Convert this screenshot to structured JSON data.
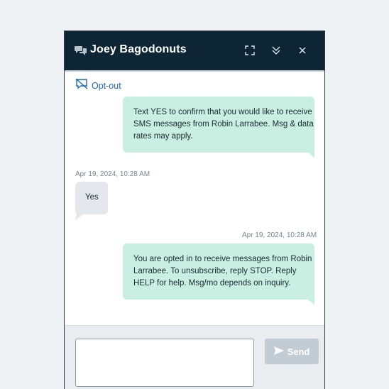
{
  "header": {
    "title": "Joey Bagodonuts",
    "icons": [
      "chat-bubbles-icon",
      "expand-icon",
      "collapse-chevrons-icon",
      "close-icon"
    ]
  },
  "toolbar": {
    "optout_label": "Opt-out"
  },
  "messages": [
    {
      "direction": "outgoing",
      "text": "Text YES to confirm that you would like to receive SMS messages from Robin Larrabee. Msg & data rates may apply.",
      "timestamp": ""
    },
    {
      "direction": "incoming",
      "text": "Yes",
      "timestamp": "Apr 19, 2024, 10:28 AM"
    },
    {
      "direction": "outgoing",
      "text": "You are opted in to receive messages from Robin Larrabee. To unsubscribe, reply STOP. Reply HELP for help. Msg/mo depends on inquiry.",
      "timestamp": "Apr 19, 2024, 10:28 AM"
    }
  ],
  "composer": {
    "placeholder": "",
    "send_label": "Send"
  },
  "colors": {
    "header_bg": "#0d2535",
    "outgoing_bubble": "#c8efe1",
    "incoming_bubble": "#e4e8ec",
    "link": "#1f67b3",
    "send_disabled": "#c2ccd4"
  }
}
